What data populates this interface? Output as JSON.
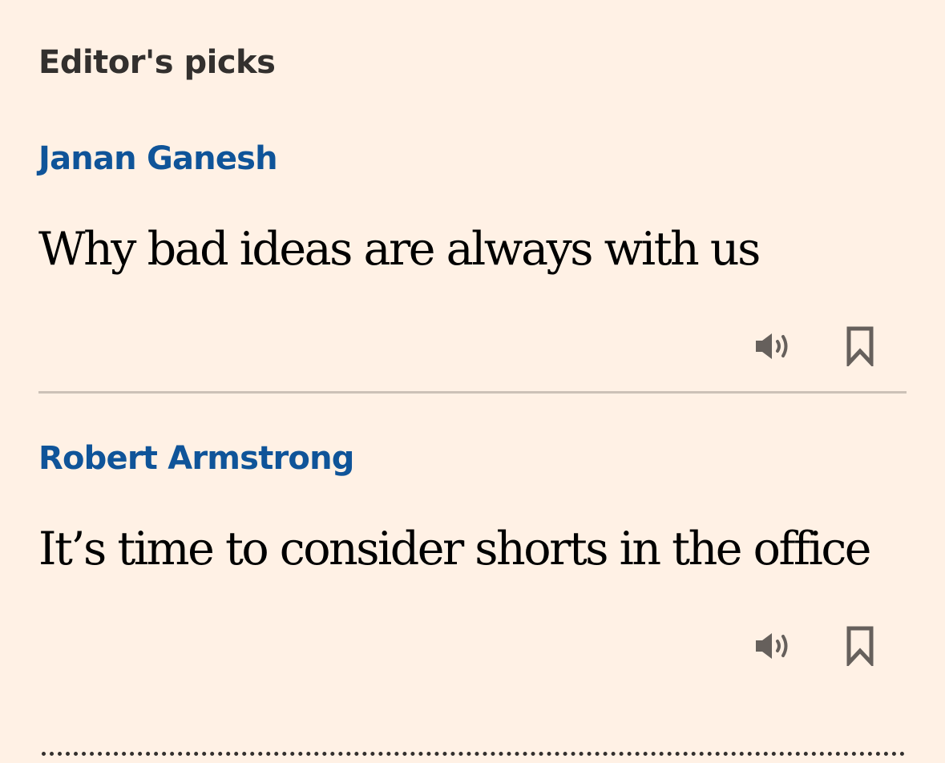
{
  "section": {
    "title": "Editor's picks"
  },
  "articles": [
    {
      "author": "Janan Ganesh",
      "headline": "Why bad ideas are always with us",
      "actions": {
        "listen_icon": "speaker-icon",
        "save_icon": "bookmark-icon"
      }
    },
    {
      "author": "Robert Armstrong",
      "headline": "It’s time to consider shorts in the office",
      "actions": {
        "listen_icon": "speaker-icon",
        "save_icon": "bookmark-icon"
      }
    }
  ],
  "colors": {
    "background": "#fff1e5",
    "author": "#0f5499",
    "headline": "#000000",
    "title": "#33302e",
    "icon": "#66605c",
    "divider": "#ccc1b7"
  }
}
